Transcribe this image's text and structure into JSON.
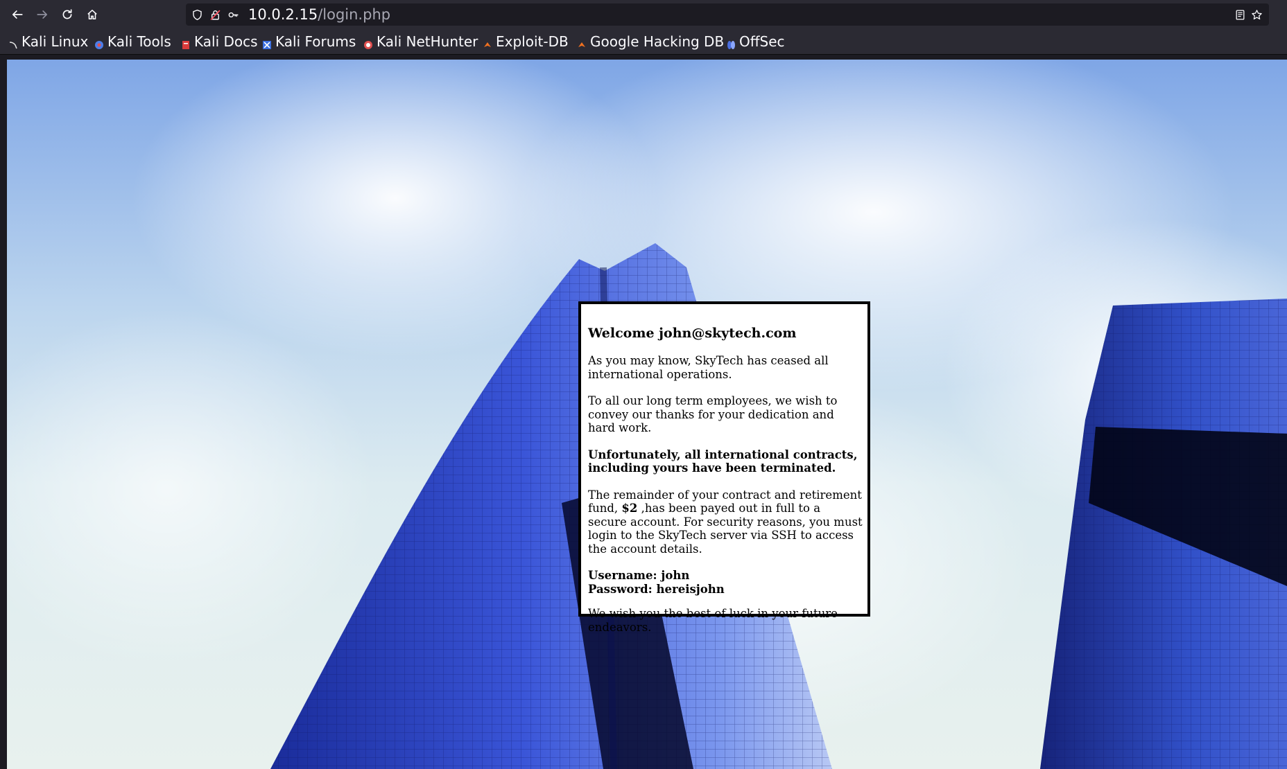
{
  "browser": {
    "url_host": "10.0.2.15",
    "url_path": "/login.php"
  },
  "bookmarks": [
    {
      "label": "Kali Linux",
      "color": "#e6e6e6"
    },
    {
      "label": "Kali Tools",
      "color": "#4d7de8"
    },
    {
      "label": "Kali Docs",
      "color": "#d93b3b"
    },
    {
      "label": "Kali Forums",
      "color": "#3b6fe0"
    },
    {
      "label": "Kali NetHunter",
      "color": "#e05050"
    },
    {
      "label": "Exploit-DB",
      "color": "#f07020"
    },
    {
      "label": "Google Hacking DB",
      "color": "#f07020"
    },
    {
      "label": "OffSec",
      "color": "#4a6ee0"
    }
  ],
  "message": {
    "heading": "Welcome john@skytech.com",
    "p1": "As you may know, SkyTech has ceased all international operations.",
    "p2": "To all our long term employees, we wish to convey our thanks for your dedication and hard work.",
    "p3": "Unfortunately, all international contracts, including yours have been terminated.",
    "p4_a": "The remainder of your contract and retirement fund, ",
    "p4_amount": "$2",
    "p4_b": " ,has been payed out in full to a secure account. For security reasons, you must login to the SkyTech server via SSH to access the account details.",
    "username_line": "Username: john",
    "password_line": "Password: hereisjohn",
    "closing": "We wish you the best of luck in your future endeavors."
  },
  "icons": {
    "back": "arrow-left-icon",
    "forward": "arrow-right-icon",
    "reload": "reload-icon",
    "home": "home-icon",
    "shield": "shield-icon",
    "insecure_lock": "lock-slash-icon",
    "key": "key-icon",
    "reader": "reader-view-icon",
    "bookmark_star": "star-icon"
  }
}
